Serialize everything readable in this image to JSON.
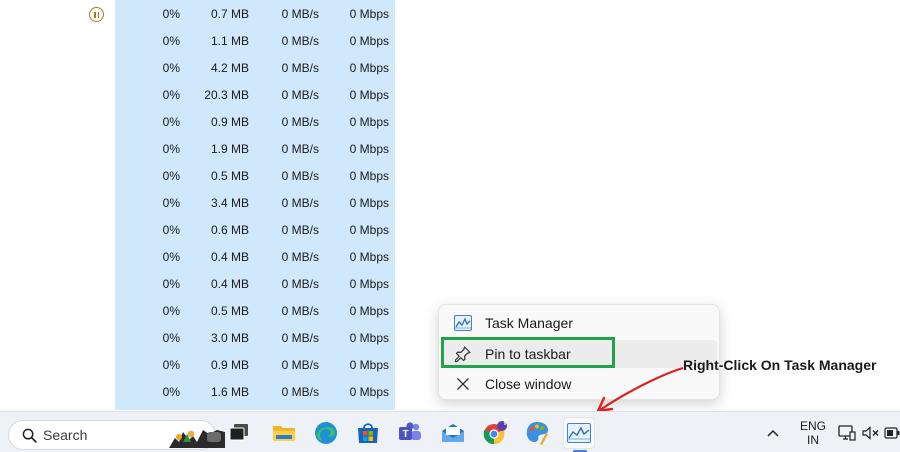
{
  "process_table": {
    "rows": [
      {
        "cpu": "0%",
        "memory": "0.7 MB",
        "disk": "0 MB/s",
        "network": "0 Mbps",
        "suspended": true
      },
      {
        "cpu": "0%",
        "memory": "1.1 MB",
        "disk": "0 MB/s",
        "network": "0 Mbps"
      },
      {
        "cpu": "0%",
        "memory": "4.2 MB",
        "disk": "0 MB/s",
        "network": "0 Mbps"
      },
      {
        "cpu": "0%",
        "memory": "20.3 MB",
        "disk": "0 MB/s",
        "network": "0 Mbps"
      },
      {
        "cpu": "0%",
        "memory": "0.9 MB",
        "disk": "0 MB/s",
        "network": "0 Mbps"
      },
      {
        "cpu": "0%",
        "memory": "1.9 MB",
        "disk": "0 MB/s",
        "network": "0 Mbps"
      },
      {
        "cpu": "0%",
        "memory": "0.5 MB",
        "disk": "0 MB/s",
        "network": "0 Mbps"
      },
      {
        "cpu": "0%",
        "memory": "3.4 MB",
        "disk": "0 MB/s",
        "network": "0 Mbps"
      },
      {
        "cpu": "0%",
        "memory": "0.6 MB",
        "disk": "0 MB/s",
        "network": "0 Mbps"
      },
      {
        "cpu": "0%",
        "memory": "0.4 MB",
        "disk": "0 MB/s",
        "network": "0 Mbps"
      },
      {
        "cpu": "0%",
        "memory": "0.4 MB",
        "disk": "0 MB/s",
        "network": "0 Mbps"
      },
      {
        "cpu": "0%",
        "memory": "0.5 MB",
        "disk": "0 MB/s",
        "network": "0 Mbps"
      },
      {
        "cpu": "0%",
        "memory": "3.0 MB",
        "disk": "0 MB/s",
        "network": "0 Mbps"
      },
      {
        "cpu": "0%",
        "memory": "0.9 MB",
        "disk": "0 MB/s",
        "network": "0 Mbps"
      },
      {
        "cpu": "0%",
        "memory": "1.6 MB",
        "disk": "0 MB/s",
        "network": "0 Mbps"
      }
    ]
  },
  "context_menu": {
    "items": [
      {
        "label": "Task Manager",
        "icon": "task-manager-icon"
      },
      {
        "label": "Pin to taskbar",
        "icon": "pin-icon"
      },
      {
        "label": "Close window",
        "icon": "close-icon"
      }
    ]
  },
  "annotation": {
    "text": "Right-Click On Task Manager",
    "highlight_color": "#22a34a",
    "arrow_color": "#e02020"
  },
  "taskbar": {
    "search_placeholder": "Search",
    "apps": [
      {
        "name": "task-view-icon"
      },
      {
        "name": "file-explorer-icon"
      },
      {
        "name": "edge-icon"
      },
      {
        "name": "microsoft-store-icon"
      },
      {
        "name": "teams-icon"
      },
      {
        "name": "mail-icon"
      },
      {
        "name": "chrome-icon",
        "badge": "T"
      },
      {
        "name": "paint-icon"
      },
      {
        "name": "task-manager-icon",
        "active": true
      }
    ],
    "tray": {
      "language_line1": "ENG",
      "language_line2": "IN"
    }
  },
  "colors": {
    "column_highlight": "#cfe8fb",
    "taskbar_bg": "#eef2f7",
    "accent": "#3a83d6"
  }
}
